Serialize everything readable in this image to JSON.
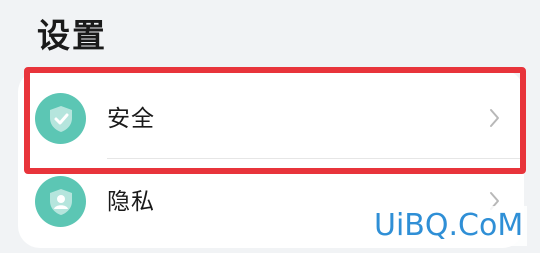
{
  "header": {
    "title": "设置"
  },
  "settings_list": {
    "items": [
      {
        "label": "安全",
        "icon": "shield-check-icon",
        "icon_color": "#5cc6b4"
      },
      {
        "label": "隐私",
        "icon": "shield-person-icon",
        "icon_color": "#5cc6b4"
      }
    ]
  },
  "annotation": {
    "highlight_color": "#e8343b"
  },
  "watermark": {
    "text": "UiBQ.CoM",
    "color": "#2f8fd6"
  }
}
